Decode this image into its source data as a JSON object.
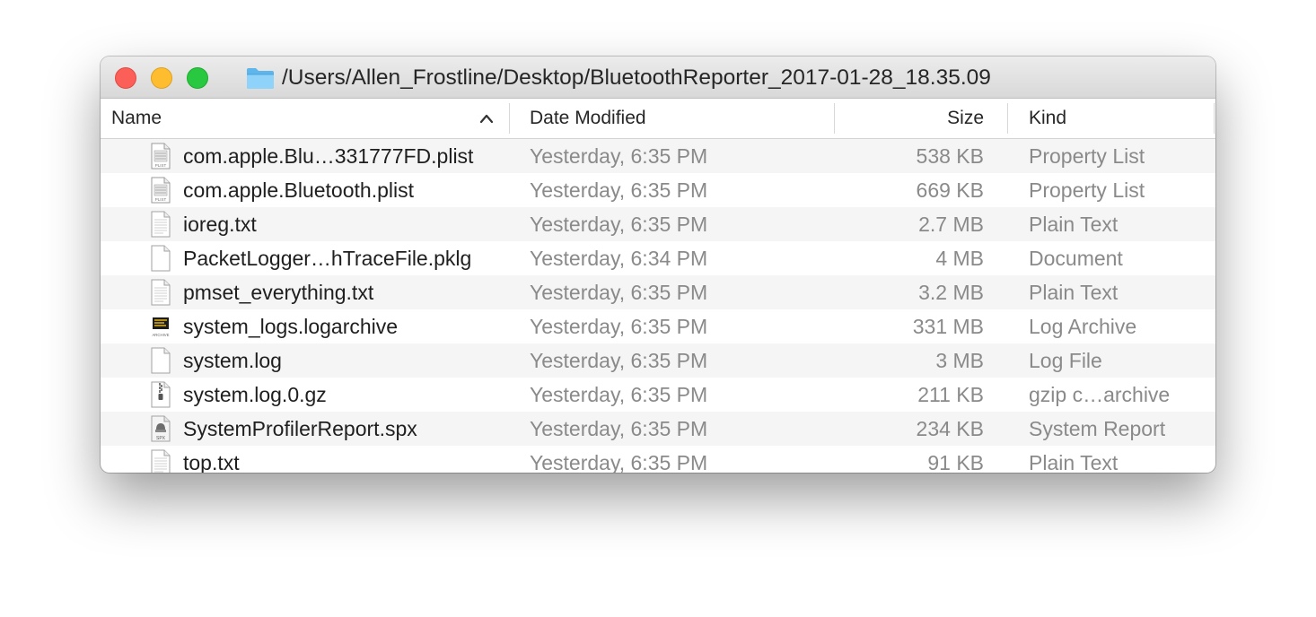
{
  "window": {
    "title": "/Users/Allen_Frostline/Desktop/BluetoothReporter_2017-01-28_18.35.09"
  },
  "columns": {
    "name": "Name",
    "date": "Date Modified",
    "size": "Size",
    "kind": "Kind"
  },
  "files": [
    {
      "name": "com.apple.Blu…331777FD.plist",
      "date": "Yesterday, 6:35 PM",
      "size": "538 KB",
      "kind": "Property List",
      "icon": "plist-icon"
    },
    {
      "name": "com.apple.Bluetooth.plist",
      "date": "Yesterday, 6:35 PM",
      "size": "669 KB",
      "kind": "Property List",
      "icon": "plist-icon"
    },
    {
      "name": "ioreg.txt",
      "date": "Yesterday, 6:35 PM",
      "size": "2.7 MB",
      "kind": "Plain Text",
      "icon": "text-file-icon"
    },
    {
      "name": "PacketLogger…hTraceFile.pklg",
      "date": "Yesterday, 6:34 PM",
      "size": "4 MB",
      "kind": "Document",
      "icon": "document-icon"
    },
    {
      "name": "pmset_everything.txt",
      "date": "Yesterday, 6:35 PM",
      "size": "3.2 MB",
      "kind": "Plain Text",
      "icon": "text-file-icon"
    },
    {
      "name": "system_logs.logarchive",
      "date": "Yesterday, 6:35 PM",
      "size": "331 MB",
      "kind": "Log Archive",
      "icon": "log-archive-icon"
    },
    {
      "name": "system.log",
      "date": "Yesterday, 6:35 PM",
      "size": "3 MB",
      "kind": "Log File",
      "icon": "document-icon"
    },
    {
      "name": "system.log.0.gz",
      "date": "Yesterday, 6:35 PM",
      "size": "211 KB",
      "kind": "gzip c…archive",
      "icon": "zip-archive-icon"
    },
    {
      "name": "SystemProfilerReport.spx",
      "date": "Yesterday, 6:35 PM",
      "size": "234 KB",
      "kind": "System Report",
      "icon": "system-report-icon"
    },
    {
      "name": "top.txt",
      "date": "Yesterday, 6:35 PM",
      "size": "91 KB",
      "kind": "Plain Text",
      "icon": "text-file-icon"
    }
  ],
  "colors": {
    "close": "#fc5f57",
    "minimize": "#fdbd2e",
    "maximize": "#28c840",
    "folder": "#6cc3f5",
    "row_alt": "#f5f5f5"
  }
}
